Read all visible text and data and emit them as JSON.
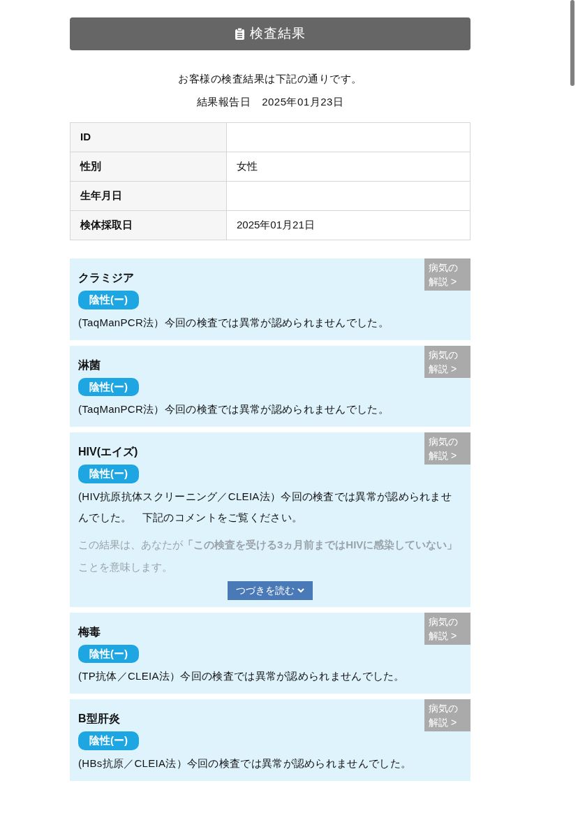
{
  "header": {
    "title": "検査結果"
  },
  "intro": "お客様の検査結果は下記の通りです。",
  "report_date": {
    "label": "結果報告日",
    "value": "2025年01月23日"
  },
  "info_table": [
    {
      "label": "ID"
    },
    {
      "label": "性別",
      "value": "女性"
    },
    {
      "label": "生年月日"
    },
    {
      "label": "検体採取日",
      "value": "2025年01月21日"
    }
  ],
  "tests": [
    {
      "name": "クラミジア",
      "result": {
        "label": "陰性(ー)",
        "kind": "negative"
      },
      "method": "(TaqManPCR法）今回の検査では異常が認められませんでした。",
      "info_link": "病気の解説 >"
    },
    {
      "name": "淋菌",
      "result": {
        "label": "陰性(ー)",
        "kind": "negative"
      },
      "method": "(TaqManPCR法）今回の検査では異常が認められませんでした。",
      "info_link": "病気の解説 >"
    },
    {
      "name": "HIV(エイズ)",
      "result": {
        "label": "陰性(ー)",
        "kind": "negative"
      },
      "method": "(HIV抗原抗体スクリーニング／CLEIA法）今回の検査では異常が認められませんでした。　下記のコメントをご覧ください。",
      "comment": "この結果は、あなたが**「この検査を受ける3ヵ月前まではHIVに感染していない」**ことを意味します。",
      "read_more": "つづきを読む",
      "info_link": "病気の解説 >"
    },
    {
      "name": "梅毒",
      "result": {
        "label": "陰性(ー)",
        "kind": "negative"
      },
      "method": "(TP抗体／CLEIA法）今回の検査では異常が認められませんでした。",
      "info_link": "病気の解説 >"
    },
    {
      "name": "B型肝炎",
      "result": {
        "label": "陰性(ー)",
        "kind": "negative"
      },
      "method": "(HBs抗原／CLEIA法）今回の検査では異常が認められませんでした。",
      "info_link": "病気の解説 >"
    }
  ]
}
